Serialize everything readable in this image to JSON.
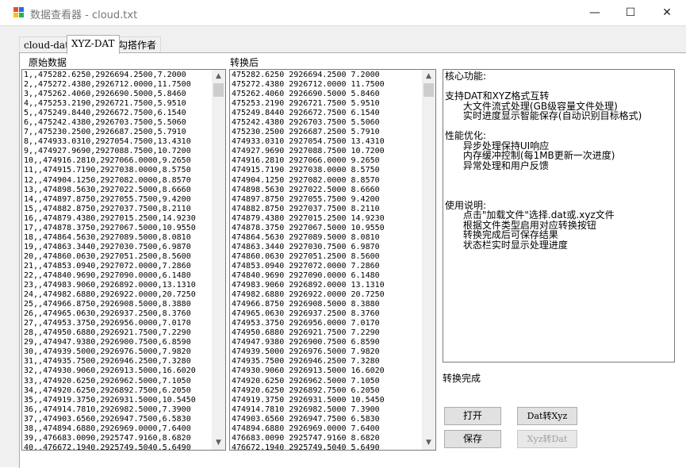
{
  "window": {
    "title": "数据查看器 - cloud.txt",
    "minimize": "—",
    "maximize": "☐",
    "close": "✕"
  },
  "tabs": [
    {
      "label": "cloud-dat",
      "active": false
    },
    {
      "label": "XYZ-DAT",
      "active": true
    },
    {
      "label": "勾搭作者",
      "active": false
    }
  ],
  "panels": {
    "original_label": "原始数据",
    "converted_label": "转换后"
  },
  "original_rows": [
    "1,,475282.6250,2926694.2500,7.2000",
    "2,,475272.4380,2926712.0000,11.7500",
    "3,,475262.4060,2926690.5000,5.8460",
    "4,,475253.2190,2926721.7500,5.9510",
    "5,,475249.8440,2926672.7500,6.1540",
    "6,,475242.4380,2926703.7500,5.5060",
    "7,,475230.2500,2926687.2500,5.7910",
    "8,,474933.0310,2927054.7500,13.4310",
    "9,,474927.9690,2927088.7500,10.7200",
    "10,,474916.2810,2927066.0000,9.2650",
    "11,,474915.7190,2927038.0000,8.5750",
    "12,,474904.1250,2927082.0000,8.8570",
    "13,,474898.5630,2927022.5000,8.6660",
    "14,,474897.8750,2927055.7500,9.4200",
    "15,,474882.8750,2927037.7500,8.2110",
    "16,,474879.4380,2927015.2500,14.9230",
    "17,,474878.3750,2927067.5000,10.9550",
    "18,,474864.5630,2927089.5000,8.0810",
    "19,,474863.3440,2927030.7500,6.9870",
    "20,,474860.0630,2927051.2500,8.5600",
    "21,,474853.0940,2927072.0000,7.2860",
    "22,,474840.9690,2927090.0000,6.1480",
    "23,,474983.9060,2926892.0000,13.1310",
    "24,,474982.6880,2926922.0000,20.7250",
    "25,,474966.8750,2926908.5000,8.3880",
    "26,,474965.0630,2926937.2500,8.3760",
    "27,,474953.3750,2926956.0000,7.0170",
    "28,,474950.6880,2926921.7500,7.2290",
    "29,,474947.9380,2926900.7500,6.8590",
    "30,,474939.5000,2926976.5000,7.9820",
    "31,,474935.7500,2926946.2500,7.3280",
    "32,,474930.9060,2926913.5000,16.6020",
    "33,,474920.6250,2926962.5000,7.1050",
    "34,,474920.6250,2926892.7500,6.2050",
    "35,,474919.3750,2926931.5000,10.5450",
    "36,,474914.7810,2926982.5000,7.3900",
    "37,,474903.6560,2926947.7500,6.5830",
    "38,,474894.6880,2926969.0000,7.6400",
    "39,,476683.0090,2925747.9160,8.6820",
    "40,,476672.1940,2925749.5040,5.6490"
  ],
  "converted_rows": [
    "475282.6250 2926694.2500 7.2000",
    "475272.4380 2926712.0000 11.7500",
    "475262.4060 2926690.5000 5.8460",
    "475253.2190 2926721.7500 5.9510",
    "475249.8440 2926672.7500 6.1540",
    "475242.4380 2926703.7500 5.5060",
    "475230.2500 2926687.2500 5.7910",
    "474933.0310 2927054.7500 13.4310",
    "474927.9690 2927088.7500 10.7200",
    "474916.2810 2927066.0000 9.2650",
    "474915.7190 2927038.0000 8.5750",
    "474904.1250 2927082.0000 8.8570",
    "474898.5630 2927022.5000 8.6660",
    "474897.8750 2927055.7500 9.4200",
    "474882.8750 2927037.7500 8.2110",
    "474879.4380 2927015.2500 14.9230",
    "474878.3750 2927067.5000 10.9550",
    "474864.5630 2927089.5000 8.0810",
    "474863.3440 2927030.7500 6.9870",
    "474860.0630 2927051.2500 8.5600",
    "474853.0940 2927072.0000 7.2860",
    "474840.9690 2927090.0000 6.1480",
    "474983.9060 2926892.0000 13.1310",
    "474982.6880 2926922.0000 20.7250",
    "474966.8750 2926908.5000 8.3880",
    "474965.0630 2926937.2500 8.3760",
    "474953.3750 2926956.0000 7.0170",
    "474950.6880 2926921.7500 7.2290",
    "474947.9380 2926900.7500 6.8590",
    "474939.5000 2926976.5000 7.9820",
    "474935.7500 2926946.2500 7.3280",
    "474930.9060 2926913.5000 16.6020",
    "474920.6250 2926962.5000 7.1050",
    "474920.6250 2926892.7500 6.2050",
    "474919.3750 2926931.5000 10.5450",
    "474914.7810 2926982.5000 7.3900",
    "474903.6560 2926947.7500 6.5830",
    "474894.6880 2926969.0000 7.6400",
    "476683.0090 2925747.9160 8.6820",
    "476672.1940 2925749.5040 5.6490"
  ],
  "info_lines": [
    "核心功能:",
    "",
    "支持DAT和XYZ格式互转",
    "      大文件流式处理(GB级容量文件处理)",
    "      实时进度显示智能保存(自动识别目标格式)",
    "",
    "性能优化:",
    "      异步处理保持UI响应",
    "      内存缓冲控制(每1MB更新一次进度)",
    "      异常处理和用户反馈",
    "",
    "",
    "",
    "使用说明:",
    "      点击\"加载文件\"选择.dat或.xyz文件",
    "      根据文件类型启用对应转换按钮",
    "      转换完成后可保存结果",
    "      状态栏实时显示处理进度"
  ],
  "status_text": "转换完成",
  "buttons": {
    "open": "打开",
    "save": "保存",
    "dat_to_xyz": "Dat转Xyz",
    "xyz_to_dat": "Xyz转Dat"
  },
  "colors": {
    "icon_red": "#e74c3c",
    "icon_blue": "#2b6cd4",
    "icon_yellow": "#f1c40f",
    "icon_green": "#27ae60"
  }
}
